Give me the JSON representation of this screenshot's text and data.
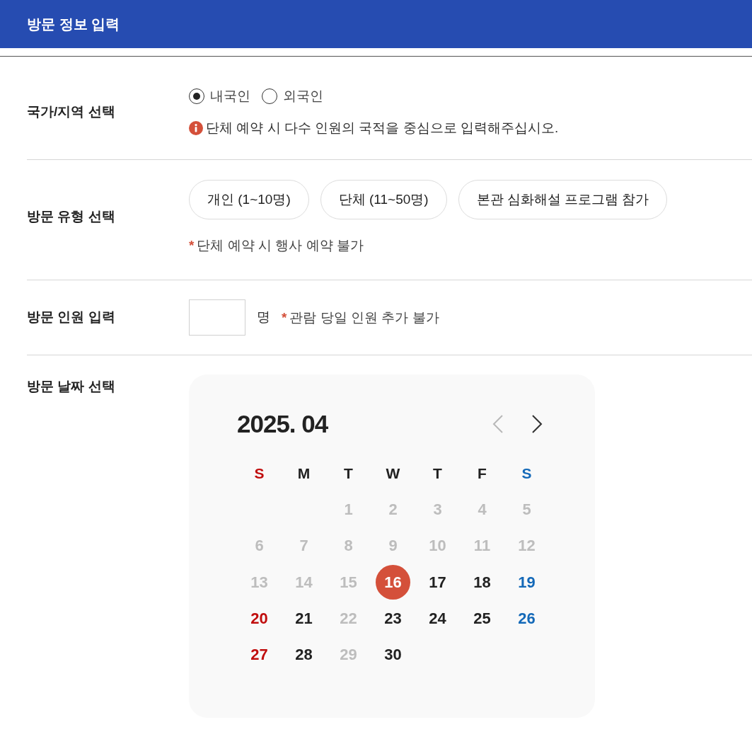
{
  "header": {
    "title": "방문 정보 입력"
  },
  "nationality": {
    "label": "국가/지역 선택",
    "options": [
      {
        "label": "내국인",
        "selected": true
      },
      {
        "label": "외국인",
        "selected": false
      }
    ],
    "notice": "단체 예약 시 다수 인원의 국적을 중심으로 입력해주십시오."
  },
  "visit_type": {
    "label": "방문 유형 선택",
    "options": [
      {
        "label": "개인 (1~10명)",
        "selected": false
      },
      {
        "label": "단체 (11~50명)",
        "selected": false
      },
      {
        "label": "본관 심화해설 프로그램 참가",
        "selected": false
      }
    ],
    "note": {
      "mark": "*",
      "text": "단체 예약 시 행사 예약 불가"
    }
  },
  "headcount": {
    "label": "방문 인원 입력",
    "unit": "명",
    "note": {
      "mark": "*",
      "text": "관람 당일 인원 추가 불가"
    }
  },
  "visit_date": {
    "label": "방문 날짜 선택",
    "calendar": {
      "month_title": "2025. 04",
      "nav": [
        {
          "kind": "prev",
          "disabled": true
        },
        {
          "kind": "next",
          "disabled": false
        }
      ],
      "weekdays": [
        {
          "label": "S",
          "color": "#c00d0d"
        },
        {
          "label": "M",
          "color": "#222222"
        },
        {
          "label": "T",
          "color": "#222222"
        },
        {
          "label": "W",
          "color": "#222222"
        },
        {
          "label": "T",
          "color": "#222222"
        },
        {
          "label": "F",
          "color": "#222222"
        },
        {
          "label": "S",
          "color": "#1469b8"
        }
      ],
      "weeks": [
        {
          "days": [
            {
              "kind": "blank"
            },
            {
              "kind": "blank"
            },
            {
              "kind": "day",
              "label": "1",
              "disabled": true,
              "selected": false
            },
            {
              "kind": "day",
              "label": "2",
              "disabled": true,
              "selected": false
            },
            {
              "kind": "day",
              "label": "3",
              "disabled": true,
              "selected": false
            },
            {
              "kind": "day",
              "label": "4",
              "disabled": true,
              "selected": false
            },
            {
              "kind": "day",
              "label": "5",
              "disabled": true,
              "selected": false
            }
          ]
        },
        {
          "days": [
            {
              "kind": "day",
              "label": "6",
              "disabled": true,
              "selected": false
            },
            {
              "kind": "day",
              "label": "7",
              "disabled": true,
              "selected": false
            },
            {
              "kind": "day",
              "label": "8",
              "disabled": true,
              "selected": false
            },
            {
              "kind": "day",
              "label": "9",
              "disabled": true,
              "selected": false
            },
            {
              "kind": "day",
              "label": "10",
              "disabled": true,
              "selected": false
            },
            {
              "kind": "day",
              "label": "11",
              "disabled": true,
              "selected": false
            },
            {
              "kind": "day",
              "label": "12",
              "disabled": true,
              "selected": false
            }
          ]
        },
        {
          "days": [
            {
              "kind": "day",
              "label": "13",
              "disabled": true,
              "selected": false
            },
            {
              "kind": "day",
              "label": "14",
              "disabled": true,
              "selected": false
            },
            {
              "kind": "day",
              "label": "15",
              "disabled": true,
              "selected": false
            },
            {
              "kind": "day",
              "label": "16",
              "disabled": false,
              "selected": true
            },
            {
              "kind": "day",
              "label": "17",
              "disabled": false,
              "selected": false
            },
            {
              "kind": "day",
              "label": "18",
              "disabled": false,
              "selected": false
            },
            {
              "kind": "day",
              "label": "19",
              "disabled": false,
              "selected": false
            }
          ]
        },
        {
          "days": [
            {
              "kind": "day",
              "label": "20",
              "disabled": false,
              "selected": false
            },
            {
              "kind": "day",
              "label": "21",
              "disabled": false,
              "selected": false
            },
            {
              "kind": "day",
              "label": "22",
              "disabled": true,
              "selected": false
            },
            {
              "kind": "day",
              "label": "23",
              "disabled": false,
              "selected": false
            },
            {
              "kind": "day",
              "label": "24",
              "disabled": false,
              "selected": false
            },
            {
              "kind": "day",
              "label": "25",
              "disabled": false,
              "selected": false
            },
            {
              "kind": "day",
              "label": "26",
              "disabled": false,
              "selected": false
            }
          ]
        },
        {
          "days": [
            {
              "kind": "day",
              "label": "27",
              "disabled": false,
              "selected": false
            },
            {
              "kind": "day",
              "label": "28",
              "disabled": false,
              "selected": false
            },
            {
              "kind": "day",
              "label": "29",
              "disabled": true,
              "selected": false
            },
            {
              "kind": "day",
              "label": "30",
              "disabled": false,
              "selected": false
            }
          ]
        }
      ]
    }
  }
}
